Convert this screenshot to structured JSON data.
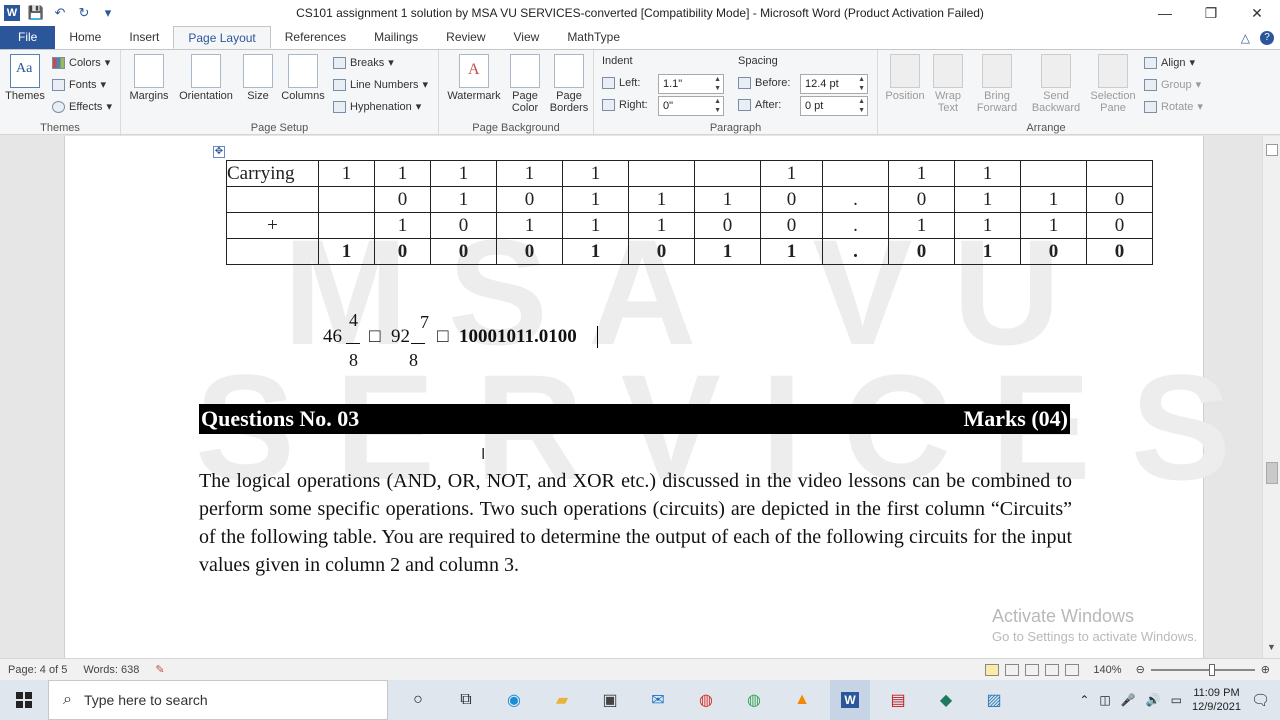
{
  "window": {
    "title": "CS101 assignment 1 solution by MSA VU SERVICES-converted [Compatibility Mode]  -  Microsoft Word (Product Activation Failed)",
    "controls": {
      "minimize": "—",
      "restore": "❐",
      "close": "✕"
    }
  },
  "tabs": [
    "Insert",
    "Page Layout",
    "References",
    "Mailings",
    "Review",
    "View",
    "MathType"
  ],
  "file_tab": "File",
  "home_tab": "Home",
  "ribbon": {
    "themes": {
      "themes": "Themes",
      "colors": "Colors",
      "fonts": "Fonts",
      "effects": "Effects",
      "group": "Themes"
    },
    "page_setup": {
      "margins": "Margins",
      "orientation": "Orientation",
      "size": "Size",
      "columns": "Columns",
      "breaks": "Breaks",
      "line_numbers": "Line Numbers",
      "hyphenation": "Hyphenation",
      "group": "Page Setup"
    },
    "page_background": {
      "watermark": "Watermark",
      "page_color": "Page Color",
      "page_borders": "Page Borders",
      "group": "Page Background"
    },
    "paragraph": {
      "indent": "Indent",
      "left": "Left:",
      "left_val": "1.1\"",
      "right": "Right:",
      "right_val": "0\"",
      "spacing": "Spacing",
      "before": "Before:",
      "before_val": "12.4 pt",
      "after": "After:",
      "after_val": "0 pt",
      "group": "Paragraph"
    },
    "arrange": {
      "position": "Position",
      "wrap_text": "Wrap Text",
      "bring_forward": "Bring Forward",
      "send_backward": "Send Backward",
      "selection_pane": "Selection Pane",
      "align": "Align",
      "group_btn": "Group",
      "rotate": "Rotate",
      "group": "Arrange"
    }
  },
  "document": {
    "table": [
      [
        "Carrying",
        "1",
        "1",
        "1",
        "1",
        "1",
        "",
        "",
        "1",
        "",
        "1",
        "1",
        "",
        ""
      ],
      [
        "",
        "",
        "0",
        "1",
        "0",
        "1",
        "1",
        "1",
        "0",
        ".",
        "0",
        "1",
        "1",
        "0"
      ],
      [
        "+",
        "",
        "1",
        "0",
        "1",
        "1",
        "1",
        "0",
        "0",
        ".",
        "1",
        "1",
        "1",
        "0"
      ],
      [
        "",
        "1",
        "0",
        "0",
        "0",
        "1",
        "0",
        "1",
        "1",
        ".",
        "0",
        "1",
        "0",
        "0"
      ]
    ],
    "equation": {
      "whole1": "46",
      "num1": "4",
      "den1": "8",
      "sym": "□",
      "whole2": "92",
      "num2": "7",
      "den2": "8",
      "result": "10001011.0100"
    },
    "question_title": "Questions No. 03",
    "marks": "Marks (04)",
    "paragraph": "The logical operations (AND, OR, NOT, and XOR etc.) discussed in the video lessons can be combined to perform some specific operations. Two such operations (circuits) are depicted in the first column “Circuits” of the following table. You are required to determine the output of each of the following circuits for the input values given in column 2 and column 3.",
    "watermark_line1": "MSA VU",
    "watermark_line2": "SERVICES"
  },
  "activation": {
    "title": "Activate Windows",
    "subtitle": "Go to Settings to activate Windows."
  },
  "status": {
    "page": "Page: 4 of 5",
    "words": "Words: 638",
    "zoom": "140%"
  },
  "taskbar": {
    "search_placeholder": "Type here to search",
    "time": "11:09 PM",
    "date": "12/9/2021"
  }
}
